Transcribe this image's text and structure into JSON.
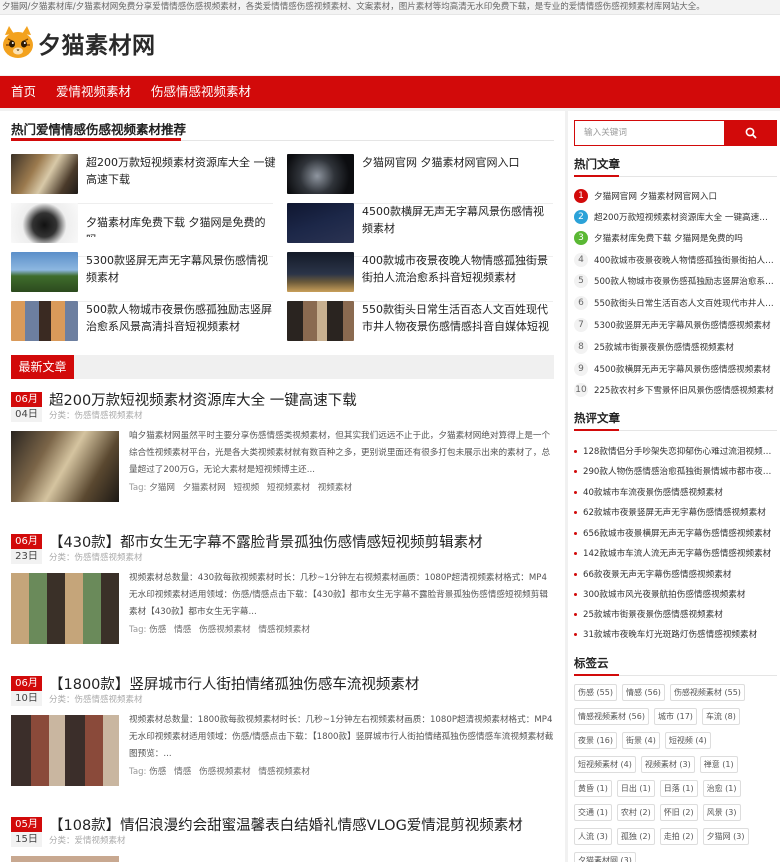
{
  "topbar": {
    "text": "夕猫网/夕猫素材库/夕猫素材网免费分享爱情情感伤感视频素材，各类爱情情感伤感视频素材、文案素材，图片素材等均高清无水印免费下载，是专业的爱情情感伤感视频素材库网站大全。"
  },
  "site": {
    "name": "夕猫素材网",
    "accent": "#d20a0a"
  },
  "nav": {
    "items": [
      "首页",
      "爱情视频素材",
      "伤感情感视频素材"
    ]
  },
  "hot": {
    "title": "热门爱情情感伤感视频素材推荐",
    "items": [
      "超200万款短视频素材资源库大全 一键高速下载",
      "夕猫网官网 夕猫素材网官网入口",
      "夕猫素材库免费下载 夕猫网是免费的吗",
      "4500款横屏无声无字幕风景伤感情视频素材",
      "5300款竖屏无声无字幕风景伤感情视频素材",
      "400款城市夜景夜晚人物情感孤独街景街拍人流治愈系抖音短视频素材",
      "500款人物城市夜景伤感孤独励志竖屏治愈系风景高清抖音短视频素材",
      "550款街头日常生活百态人文百姓现代市井人物夜景伤感情感抖音自媒体短视频素材"
    ]
  },
  "latest": {
    "tab": "最新文章",
    "articles": [
      {
        "month": "06月",
        "day": "04日",
        "title": "超200万款短视频素材资源库大全 一键高速下载",
        "cat": "分类：伤感情感视频素材",
        "desc": "咱夕猫素材网虽然平时主要分享伤感情感类视频素材，但其实我们远远不止于此，夕猫素材网绝对算得上是一个综合性视频素材平台，光是各大类视频素材就有数百种之多，更别说里面还有很多打包未展示出来的素材了，总量超过了200万G，无论大素材是短视频博主还...",
        "tags_label": "Tag:",
        "tags": [
          "夕猫网",
          "夕猫素材网",
          "短视频",
          "短视频素材",
          "视频素材"
        ]
      },
      {
        "month": "06月",
        "day": "23日",
        "title": "【430款】都市女生无字幕不露脸背景孤独伤感情感短视频剪辑素材",
        "cat": "分类：伤感情感视频素材",
        "desc": "视频素材总数量：430款每款视频素材时长：几秒~1分钟左右视频素材画质：1080P超清视频素材格式：MP4 无水印视频素材适用领域：伤感/情感点击下载：【430款】都市女生无字幕不露脸背景孤独伤感情感短视频剪辑素材【430款】都市女生无字幕...",
        "tags_label": "Tag:",
        "tags": [
          "伤感",
          "情感",
          "伤感视频素材",
          "情感视频素材"
        ]
      },
      {
        "month": "06月",
        "day": "10日",
        "title": "【1800款】竖屏城市行人街拍情绪孤独伤感车流视频素材",
        "cat": "分类：伤感情感视频素材",
        "desc": "视频素材总数量：1800款每款视频素材时长：几秒~1分钟左右视频素材画质：1080P超清视频素材格式：MP4 无水印视频素材适用领域：伤感/情感点击下载：【1800款】竖屏城市行人街拍情绪孤独伤感情感车流视频素材截图预览：...",
        "tags_label": "Tag:",
        "tags": [
          "伤感",
          "情感",
          "伤感视频素材",
          "情感视频素材"
        ]
      },
      {
        "month": "05月",
        "day": "15日",
        "title": "【108款】情侣浪漫约会甜蜜温馨表白结婚礼情感VLOG爱情混剪视频素材",
        "cat": "分类：爱情视频素材",
        "desc": "",
        "tags_label": "",
        "tags": []
      }
    ]
  },
  "sidebar": {
    "search_placeholder": "输入关键词",
    "hot_title": "热门文章",
    "hot_items": [
      "夕猫网官网 夕猫素材网官网入口",
      "超200万款短视频素材资源库大全 一键高速下载",
      "夕猫素材库免费下载 夕猫网是免费的吗",
      "400款城市夜景夜晚人物情感孤独街景街拍人流治愈系抖音短视频素材",
      "500款人物城市夜景伤感孤独励志竖屏治愈系风景高清抖音短视频素材",
      "550款街头日常生活百态人文百姓现代市井人物夜景伤感情感抖音自媒体短视频素材",
      "5300款竖屏无声无字幕风景伤感情感视频素材",
      "25款城市街景夜景伤感情感视频素材",
      "4500款横屏无声无字幕风景伤感情感视频素材",
      "225款农村乡下雪景怀旧风景伤感情感视频素材"
    ],
    "comment_title": "热评文章",
    "comment_items": [
      "128款情侣分手吵架失恋抑郁伤心难过流泪视频素材",
      "290款人物伤感情感治愈孤独街景情城市都市夜景视频素材",
      "40款城市车流夜景伤感情感视频素材",
      "62款城市夜景竖屏无声无字幕伤感情感视频素材",
      "656款城市夜景横屏无声无字幕伤感情感视频素材",
      "142款城市车流人流无声无字幕伤感情感视频素材",
      "66款夜景无声无字幕伤感情感视频素材",
      "300款城市风光夜景航拍伤感情感视频素材",
      "25款城市街景夜景伤感情感视频素材",
      "31款城市夜晚车灯光斑路灯伤感情感视频素材"
    ],
    "tags_title": "标签云",
    "tags": [
      "伤感 (55)",
      "情感 (56)",
      "伤感视频素材 (55)",
      "情感视频素材 (56)",
      "城市 (17)",
      "车流 (8)",
      "夜景 (16)",
      "街景 (4)",
      "短视频 (4)",
      "短视频素材 (4)",
      "视频素材 (3)",
      "禅意 (1)",
      "黄昏 (1)",
      "日出 (1)",
      "日落 (1)",
      "治愈 (1)",
      "交通 (1)",
      "农村 (2)",
      "怀旧 (2)",
      "风景 (3)",
      "人流 (3)",
      "孤独 (2)",
      "走拍 (2)",
      "夕猫网 (3)",
      "夕猫素材网 (3)"
    ]
  }
}
